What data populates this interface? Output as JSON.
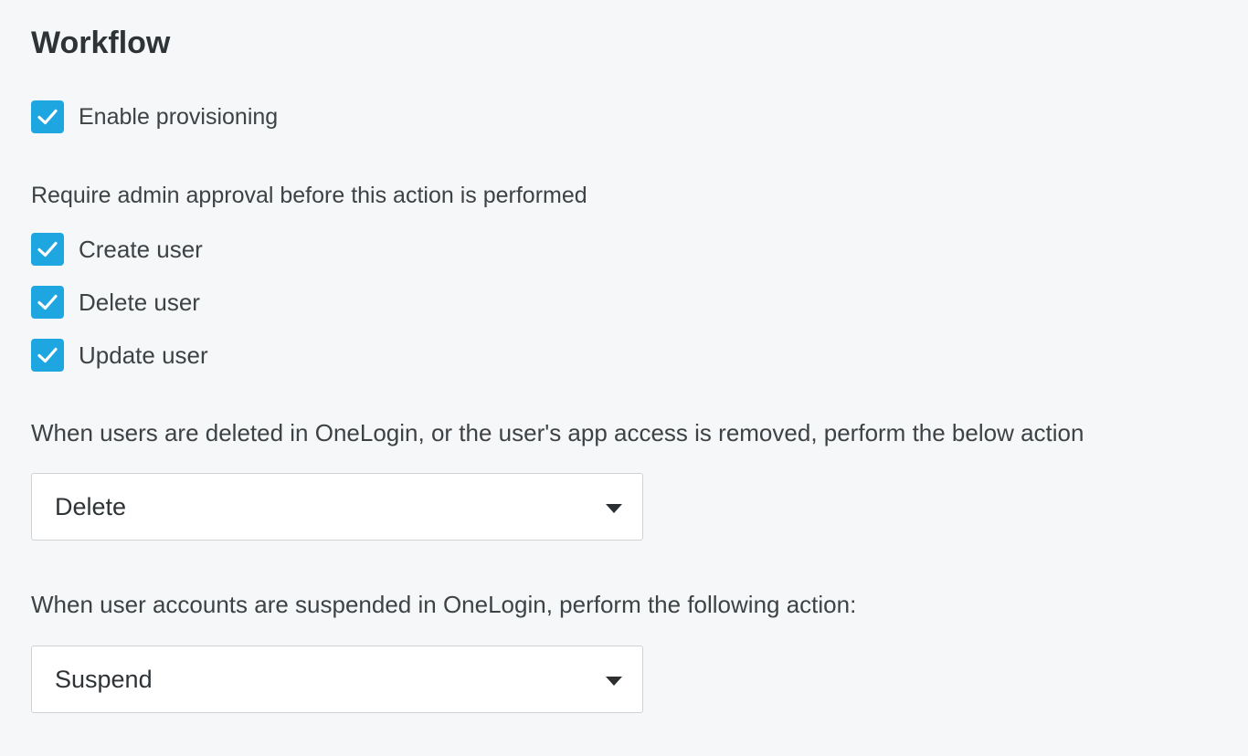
{
  "workflow": {
    "title": "Workflow",
    "enable_provisioning": {
      "label": "Enable provisioning",
      "checked": true
    },
    "approval_heading": "Require admin approval before this action is performed",
    "approvals": [
      {
        "label": "Create user",
        "checked": true
      },
      {
        "label": "Delete user",
        "checked": true
      },
      {
        "label": "Update user",
        "checked": true
      }
    ],
    "deletion_prompt": "When users are deleted in OneLogin, or the user's app access is removed, perform the below action",
    "deletion_action": {
      "selected": "Delete"
    },
    "suspension_prompt": "When user accounts are suspended in OneLogin, perform the following action:",
    "suspension_action": {
      "selected": "Suspend"
    }
  },
  "colors": {
    "accent": "#1ea6e0",
    "background": "#f6f7f8",
    "text": "#3d4245"
  },
  "icons": {
    "checkbox": "checkmark-icon",
    "dropdown": "caret-down-icon"
  }
}
